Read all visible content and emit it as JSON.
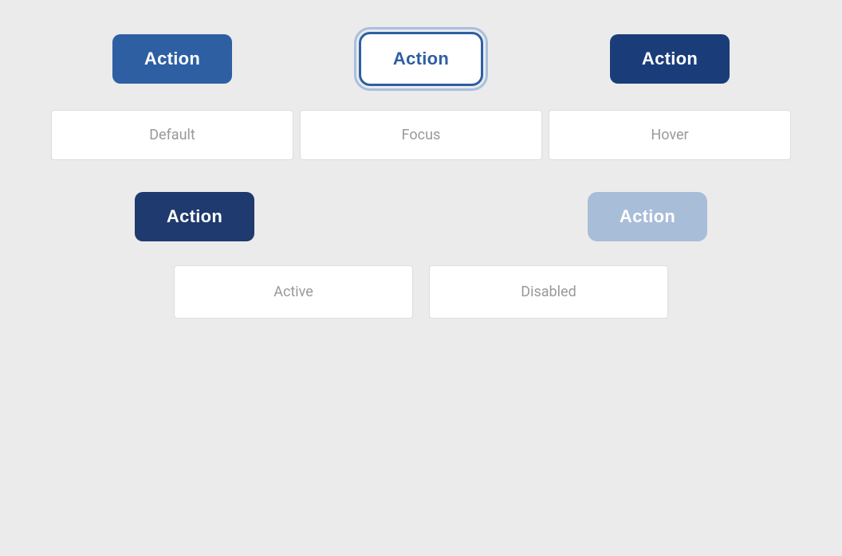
{
  "background_color": "#ebebeb",
  "row1": {
    "buttons": [
      {
        "id": "default-btn",
        "label": "Action",
        "state": "default",
        "bg_color": "#2e5fa3",
        "text_color": "#ffffff"
      },
      {
        "id": "focus-btn",
        "label": "Action",
        "state": "focus",
        "bg_color": "#ffffff",
        "text_color": "#2e5fa3"
      },
      {
        "id": "hover-btn",
        "label": "Action",
        "state": "hover",
        "bg_color": "#1a3d7a",
        "text_color": "#ffffff"
      }
    ],
    "labels": [
      "Default",
      "Focus",
      "Hover"
    ]
  },
  "row2": {
    "buttons": [
      {
        "id": "active-btn",
        "label": "Action",
        "state": "active",
        "bg_color": "#1e3a6e",
        "text_color": "#ffffff"
      },
      {
        "id": "disabled-btn",
        "label": "Action",
        "state": "disabled",
        "bg_color": "#a8bdd8",
        "text_color": "#ffffff"
      }
    ],
    "labels": [
      "Active",
      "Disabled"
    ]
  }
}
